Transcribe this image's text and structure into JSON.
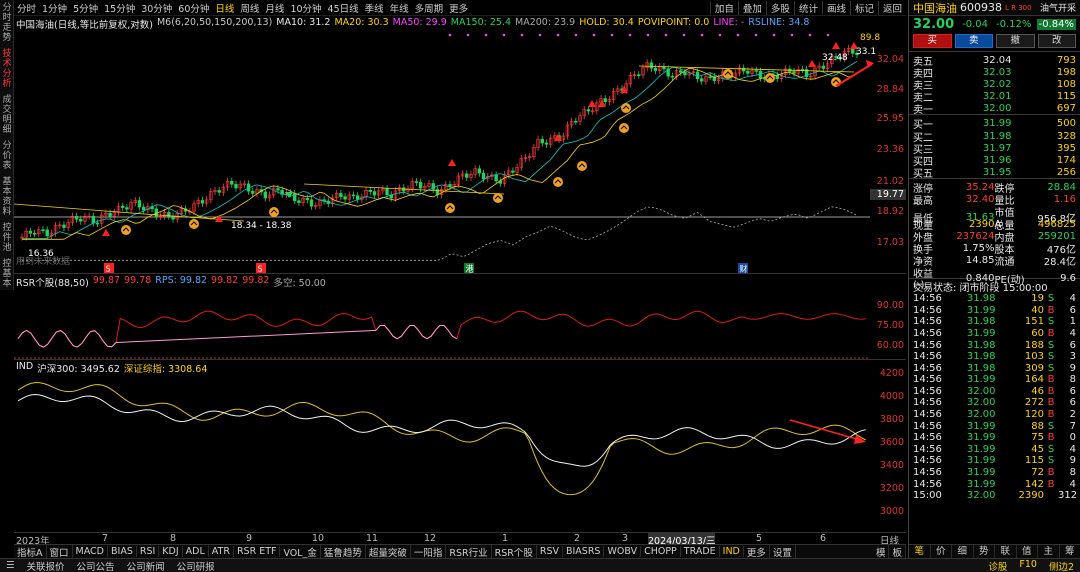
{
  "left_tabs": [
    "分时走势",
    "技术分析",
    "成交明细",
    "分价表",
    "基本资料",
    "控件池",
    "控基本"
  ],
  "timeframes": [
    "分时",
    "1分钟",
    "5分钟",
    "15分钟",
    "30分钟",
    "60分钟",
    "日线",
    "周线",
    "月线",
    "10分钟",
    "45日线",
    "季线",
    "年线",
    "多周期",
    "更多"
  ],
  "active_timeframe": "日线",
  "tools": [
    "加自",
    "叠加",
    "多股",
    "统计",
    "画线",
    "标记",
    "返回"
  ],
  "legend": {
    "name": "中国海油(日线,等比前复权,对数)",
    "ma": "M6(6,20,50,150,200,13)",
    "ma10": "MA10: 31.2",
    "ma20": "MA20: 30.3",
    "ma50": "MA50: 29.9",
    "ma150": "MA150: 25.4",
    "ma200": "MA200: 23.9",
    "hold": "HOLD: 30.4",
    "pivot": "POVIPOINT: 0.0",
    "line": "LINE: -",
    "rsline": "RSLINE: 34.8"
  },
  "price_axis": [
    "32.04",
    "28.84",
    "25.95",
    "23.36",
    "21.02",
    "19.77",
    "18.92",
    "17.03"
  ],
  "price_labels": {
    "low": "16.36",
    "range": "18.34 - 18.38",
    "high1": "32.48",
    "high2": "33.1",
    "high3": "89.8",
    "future": "用到未来数据"
  },
  "chart_data": {
    "type": "line",
    "main": {
      "x_start": "2023-05",
      "x_end": "2024-06",
      "price_min": 16.36,
      "price_max": 33.1,
      "close_path": [
        17.2,
        17.6,
        17.4,
        17.8,
        18.2,
        18.4,
        18.1,
        18.6,
        18.9,
        19.3,
        19.0,
        18.6,
        18.4,
        18.7,
        19.1,
        19.6,
        20.2,
        20.6,
        20.4,
        20.0,
        19.8,
        20.2,
        19.6,
        19.4,
        19.2,
        19.5,
        19.8,
        19.6,
        19.9,
        20.1,
        19.8,
        20.2,
        20.6,
        20.4,
        20.0,
        20.6,
        21.2,
        21.4,
        21.0,
        20.8,
        21.6,
        22.4,
        23.6,
        23.8,
        24.2,
        25.6,
        26.2,
        27.0,
        27.6,
        28.6,
        29.8,
        30.6,
        30.2,
        29.6,
        30.0,
        29.4,
        29.2,
        29.6,
        29.8,
        30.2,
        29.6,
        29.4,
        29.8,
        30.2,
        29.6,
        30.4,
        31.2,
        32.0,
        32.04
      ]
    },
    "rsr": {
      "label": "RSR个股(88,50)",
      "values": [
        "99.87",
        "99.78",
        "99.82",
        "99.82"
      ],
      "rps": "RPS: 99.82",
      "multi": "多空: 50.00",
      "axis": [
        "90.00",
        "75.00",
        "60.00"
      ]
    },
    "ind": {
      "label": "IND",
      "hs300": "沪深300: 3495.62",
      "szcz": "深证综指: 3308.64",
      "axis": [
        "4200",
        "4000",
        "3800",
        "3600",
        "3400",
        "3200",
        "3000"
      ]
    }
  },
  "date_labels": [
    "2023年",
    "7",
    "8",
    "9",
    "10",
    "11",
    "12",
    "1",
    "2",
    "3",
    "2024/03/13/三",
    "5",
    "6",
    "日线"
  ],
  "ind_tabs": [
    "指标A",
    "窗口",
    "MACD",
    "BIAS",
    "RSI",
    "KDJ",
    "ADL",
    "ATR",
    "RSR ETF",
    "VOL_金",
    "猛鲁趋势",
    "超量突破",
    "一阳指",
    "RSR行业",
    "RSR个股",
    "RSV",
    "BIASRS",
    "WOBV",
    "CHOPP",
    "TRADE",
    "IND",
    "更多",
    "设置"
  ],
  "ind_tab_right": [
    "模",
    "板"
  ],
  "status_bar": [
    "关联报价",
    "公司公告",
    "公司新闻",
    "公司研报"
  ],
  "status_right": [
    "诊股",
    "F10",
    "侧边2"
  ],
  "right": {
    "stock_name": "中国海油",
    "code": "600938",
    "tags": "L R 300",
    "sector": "油气开采",
    "sector_pct": "-0.84%",
    "price": "32.00",
    "change": "-0.04",
    "change_pct": "-0.12%",
    "buttons": [
      "买",
      "卖",
      "撤",
      "改"
    ],
    "asks": [
      [
        "卖五",
        "32.04",
        "793"
      ],
      [
        "卖四",
        "32.03",
        "198"
      ],
      [
        "卖三",
        "32.02",
        "108"
      ],
      [
        "卖二",
        "32.01",
        "115"
      ],
      [
        "卖一",
        "32.00",
        "697"
      ]
    ],
    "bids": [
      [
        "买一",
        "31.99",
        "500"
      ],
      [
        "买二",
        "31.98",
        "328"
      ],
      [
        "买三",
        "31.97",
        "395"
      ],
      [
        "买四",
        "31.96",
        "174"
      ],
      [
        "买五",
        "31.95",
        "256"
      ]
    ],
    "stats": [
      [
        "涨停",
        "35.24",
        "跌停",
        "28.84"
      ],
      [
        "最高",
        "32.40",
        "量比",
        "1.16"
      ],
      [
        "最低",
        "31.63",
        "市值A",
        "956.8亿"
      ],
      [
        "现量",
        "2390",
        "总量",
        "496825"
      ],
      [
        "外盘",
        "237624",
        "内盘",
        "259201"
      ],
      [
        "换手",
        "1.75%",
        "股本",
        "476亿"
      ],
      [
        "净资",
        "14.85",
        "流通",
        "28.4亿"
      ],
      [
        "收益(-)",
        "0.840",
        "PE(动)",
        "9.6"
      ]
    ],
    "trade_status": "交易状态: 闭市阶段 15:00:00",
    "ticks": [
      [
        "14:56",
        "31.98",
        "19",
        "S",
        "4"
      ],
      [
        "14:56",
        "31.99",
        "40",
        "B",
        "6"
      ],
      [
        "14:56",
        "31.98",
        "151",
        "S",
        "1"
      ],
      [
        "14:56",
        "31.99",
        "60",
        "B",
        "4"
      ],
      [
        "14:56",
        "31.98",
        "188",
        "S",
        "6"
      ],
      [
        "14:56",
        "31.98",
        "103",
        "S",
        "3"
      ],
      [
        "14:56",
        "31.98",
        "309",
        "S",
        "9"
      ],
      [
        "14:56",
        "31.99",
        "164",
        "B",
        "8"
      ],
      [
        "14:56",
        "32.00",
        "46",
        "B",
        "6"
      ],
      [
        "14:56",
        "32.00",
        "272",
        "B",
        "6"
      ],
      [
        "14:56",
        "32.00",
        "120",
        "B",
        "2"
      ],
      [
        "14:56",
        "31.99",
        "88",
        "S",
        "7"
      ],
      [
        "14:56",
        "31.99",
        "75",
        "B",
        "0"
      ],
      [
        "14:56",
        "31.99",
        "45",
        "S",
        "4"
      ],
      [
        "14:56",
        "31.99",
        "115",
        "S",
        "9"
      ],
      [
        "14:56",
        "31.99",
        "72",
        "B",
        "8"
      ],
      [
        "14:56",
        "31.99",
        "142",
        "B",
        "4"
      ],
      [
        "15:00",
        "32.00",
        "2390",
        "",
        "312"
      ]
    ],
    "bottom_tabs": [
      "笔",
      "价",
      "细",
      "势",
      "联",
      "值",
      "主",
      "筹"
    ]
  },
  "colors": {
    "up": "#ff3b3b",
    "down": "#22d35c",
    "ma": "#ffd400",
    "accent": "#ffd400"
  }
}
